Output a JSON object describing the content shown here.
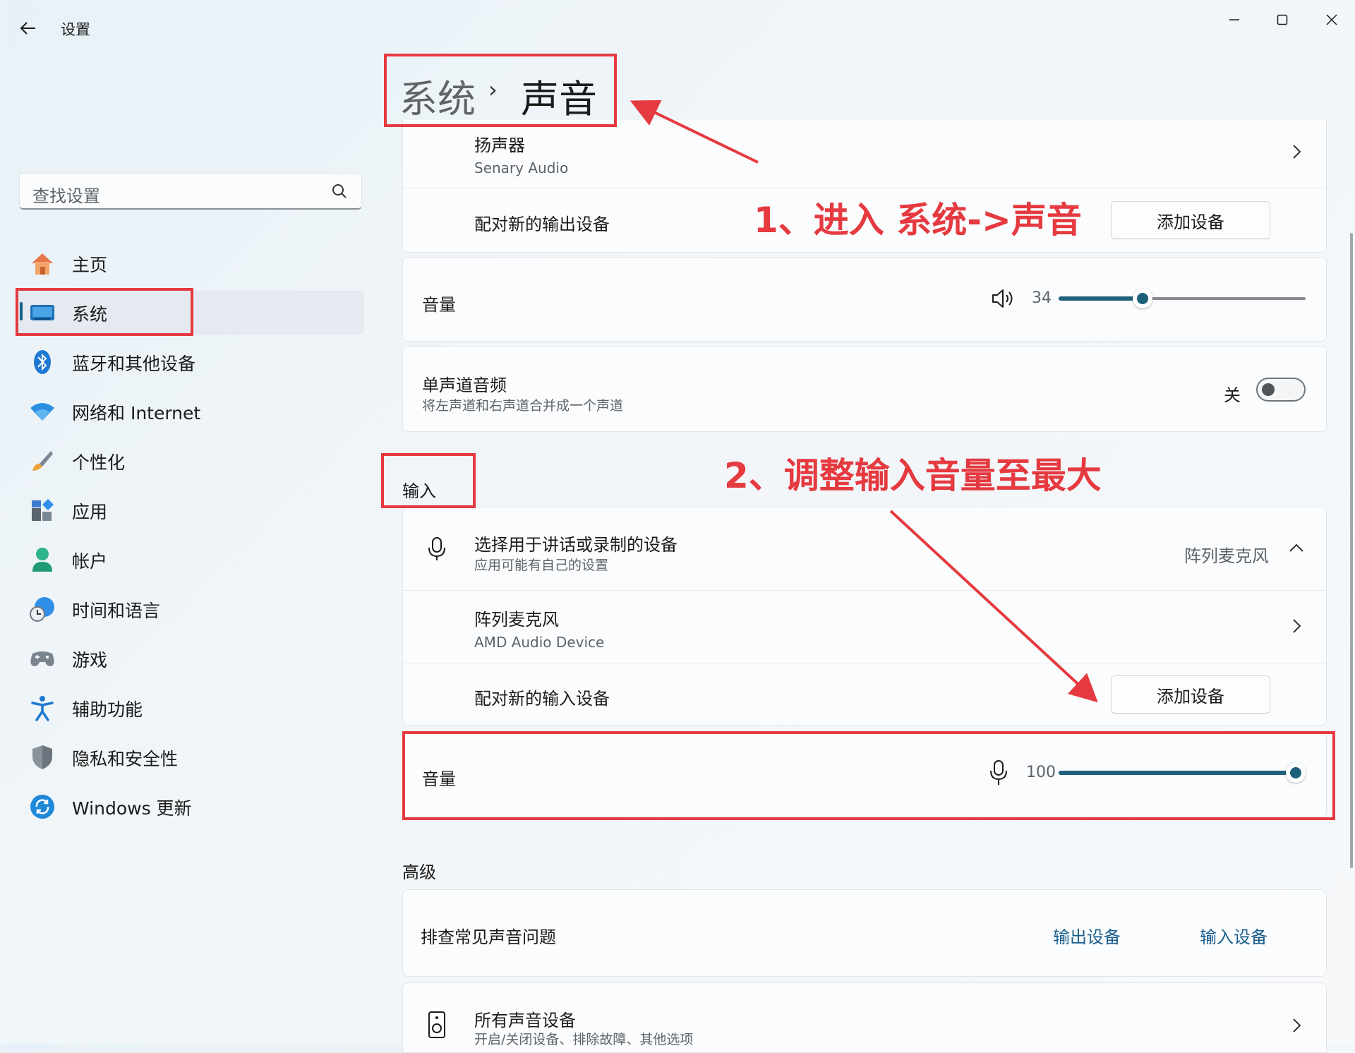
{
  "window": {
    "title": "设置",
    "controls": {
      "minimize": "minimize-icon",
      "maximize": "maximize-icon",
      "close": "close-icon"
    }
  },
  "sidebar": {
    "search_placeholder": "查找设置",
    "items": [
      {
        "label": "主页",
        "icon": "home-icon"
      },
      {
        "label": "系统",
        "icon": "system-icon",
        "active": true
      },
      {
        "label": "蓝牙和其他设备",
        "icon": "bluetooth-icon"
      },
      {
        "label": "网络和 Internet",
        "icon": "wifi-icon"
      },
      {
        "label": "个性化",
        "icon": "brush-icon"
      },
      {
        "label": "应用",
        "icon": "apps-icon"
      },
      {
        "label": "帐户",
        "icon": "account-icon"
      },
      {
        "label": "时间和语言",
        "icon": "clock-globe-icon"
      },
      {
        "label": "游戏",
        "icon": "gamepad-icon"
      },
      {
        "label": "辅助功能",
        "icon": "accessibility-icon"
      },
      {
        "label": "隐私和安全性",
        "icon": "shield-icon"
      },
      {
        "label": "Windows 更新",
        "icon": "update-icon"
      }
    ]
  },
  "breadcrumb": {
    "parent": "系统",
    "separator": "›",
    "current": "声音"
  },
  "output": {
    "speaker": {
      "name": "扬声器",
      "desc": "Senary Audio"
    },
    "pair_label": "配对新的输出设备",
    "pair_button": "添加设备",
    "volume_label": "音量",
    "volume_value": "34",
    "volume_level": 34,
    "mono": {
      "title": "单声道音频",
      "desc": "将左声道和右声道合并成一个声道",
      "state": "关",
      "on": false
    }
  },
  "input": {
    "heading": "输入",
    "choose": {
      "title": "选择用于讲话或录制的设备",
      "desc": "应用可能有自己的设置",
      "value": "阵列麦克风"
    },
    "device": {
      "name": "阵列麦克风",
      "desc": "AMD Audio Device"
    },
    "pair_label": "配对新的输入设备",
    "pair_button": "添加设备",
    "volume_label": "音量",
    "volume_value": "100",
    "volume_level": 100
  },
  "advanced": {
    "heading": "高级",
    "troubleshoot": {
      "title": "排查常见声音问题",
      "output_link": "输出设备",
      "input_link": "输入设备"
    },
    "all_devices": {
      "title": "所有声音设备",
      "desc": "开启/关闭设备、排除故障、其他选项"
    }
  },
  "annotations": {
    "step1": "1、进入 系统->声音",
    "step2": "2、调整输入音量至最大",
    "color": "#e53a40"
  },
  "colors": {
    "accent": "#1e5f7a",
    "link": "#1a5e8c"
  }
}
